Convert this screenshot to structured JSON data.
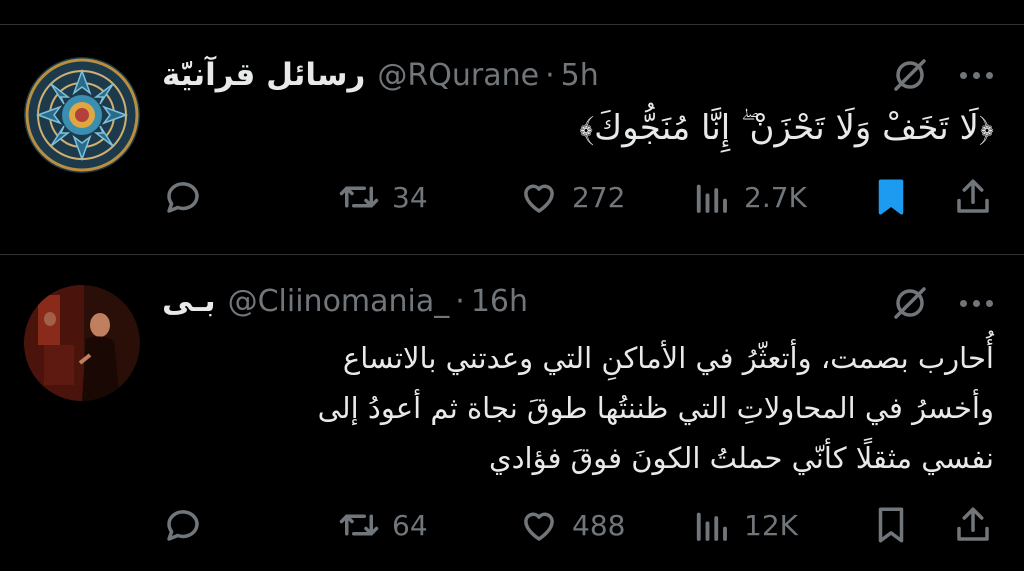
{
  "tweets": [
    {
      "author_name": "رسائل قرآنيّة",
      "handle": "@RQurane",
      "separator": "·",
      "time": "5h",
      "text": "﴿لَا تَخَفْ وَلَا تَحْزَنْ ۖ إِنَّا مُنَجُّوكَ﴾",
      "replies": "",
      "retweets": "34",
      "likes": "272",
      "views": "2.7K",
      "bookmarked": true
    },
    {
      "author_name": "بـى",
      "handle": "@Cliinomania_",
      "separator": "·",
      "time": "16h",
      "text": "أُحارب بصمت، وأتعثّرُ في الأماكنِ التي وعدتني بالاتساع\nوأخسرُ في المحاولاتِ التي ظننتُها طوقَ نجاة ثم أعودُ إلى\nنفسي مثقلًا كأنّي حملتُ الكونَ فوقَ فؤادي",
      "replies": "",
      "retweets": "64",
      "likes": "488",
      "views": "12K",
      "bookmarked": false
    }
  ],
  "colors": {
    "background": "#000000",
    "text": "#e7e9ea",
    "muted": "#71767b",
    "accent": "#1d9bf0",
    "divider": "#2f3336"
  },
  "icons": [
    "reply-icon",
    "retweet-icon",
    "like-icon",
    "views-icon",
    "bookmark-icon",
    "share-icon",
    "grok-icon",
    "more-icon"
  ]
}
